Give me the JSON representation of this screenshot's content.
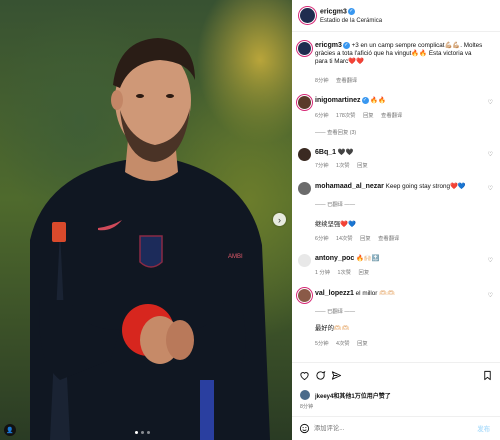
{
  "post": {
    "author": "ericgm3",
    "location": "Estadio de la Cerámica",
    "caption_author": "ericgm3",
    "caption_text": "+3 en un camp sempre complicat💪🏼💪🏼. Moltes gràcies a tota l'afició que ha vingut🔥🔥 Esta victoria va para ti Marc❤️❤️",
    "caption_time": "8分钟",
    "caption_translate": "查看翻译"
  },
  "comments": [
    {
      "user": "inigomartinez",
      "text": "🔥🔥",
      "time": "6分钟",
      "likes": "178次赞",
      "reply": "回复",
      "translate": "查看翻译",
      "view_replies": "—— 查看回复 (3)"
    },
    {
      "user": "6Bq_1",
      "text": "🖤🖤",
      "time": "7分钟",
      "likes": "1次赞",
      "reply": "回复"
    },
    {
      "user": "mohamaad_al_nezar",
      "text": "Keep going stay strong❤️💙",
      "translated_label": "—— 已翻译 ——",
      "translated_text": "继续坚强❤️💙",
      "time": "6分钟",
      "likes": "14次赞",
      "reply": "回复",
      "translate": "查看翻译"
    },
    {
      "user": "antony_poc",
      "text": "🔥🙌🏻🔝",
      "time": "1 分钟",
      "likes": "1次赞",
      "reply": "回复"
    },
    {
      "user": "val_lopezz1",
      "text": "el millor 🫶🏻🫶🏻",
      "translated_label": "—— 已翻译 ——",
      "translated_text": "最好的🫶🏻🫶🏻",
      "time": "5分钟",
      "likes": "4次赞",
      "reply": "回复"
    }
  ],
  "actions": {
    "likes_text": "jkeey4和其他1万位用户赞了",
    "date": "8分钟"
  },
  "add_comment": {
    "placeholder": "添加评论...",
    "post_label": "发布"
  },
  "colors": {
    "accent": "#3897f0",
    "like_red": "#ed4956",
    "jersey": "#0f1a2b"
  },
  "icons": [
    "heart-icon",
    "comment-icon",
    "share-icon",
    "bookmark-icon",
    "emoji-icon",
    "chevron-right-icon",
    "verified-icon"
  ]
}
